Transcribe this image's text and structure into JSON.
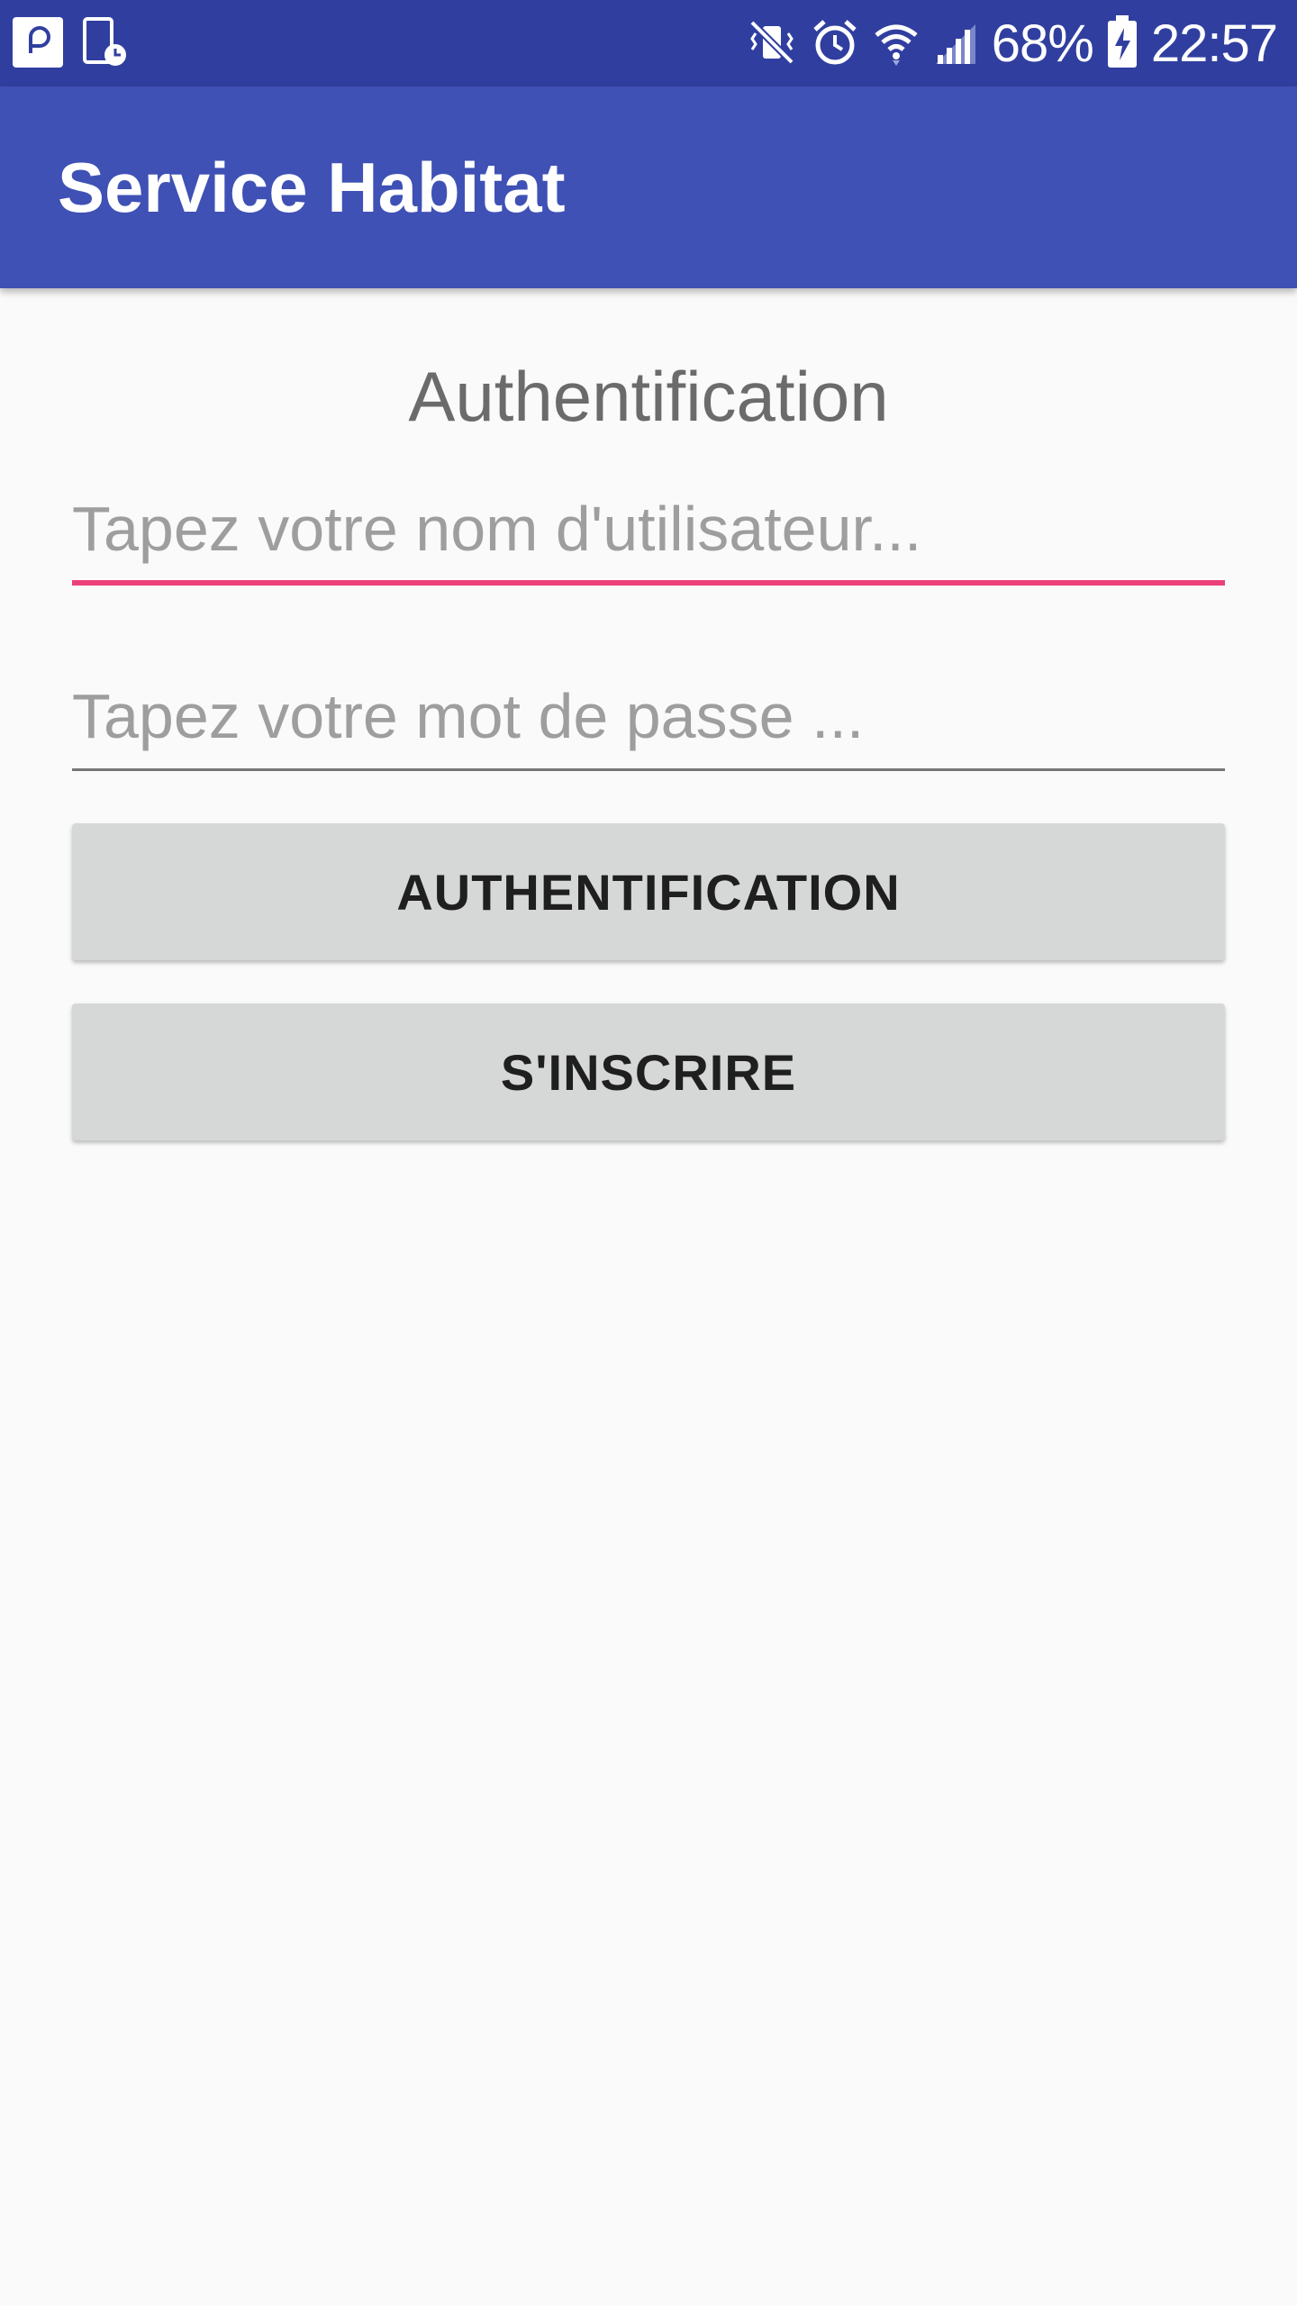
{
  "status_bar": {
    "battery": "68%",
    "time": "22:57",
    "icons": [
      "app-notification-icon",
      "screenshot-notification-icon",
      "mute-vibrate-icon",
      "alarm-icon",
      "wifi-icon",
      "cellular-signal-icon",
      "battery-charging-icon"
    ]
  },
  "app_bar": {
    "title": "Service Habitat"
  },
  "main": {
    "heading": "Authentification",
    "username_field": {
      "placeholder": "Tapez votre nom d'utilisateur...",
      "value": ""
    },
    "password_field": {
      "placeholder": "Tapez votre mot de passe ...",
      "value": ""
    },
    "login_button_label": "AUTHENTIFICATION",
    "signup_button_label": "S'INSCRIRE"
  },
  "colors": {
    "status_bar": "#303f9f",
    "app_bar": "#3f51b5",
    "accent": "#ec407a",
    "background": "#fafafa",
    "button": "#d6d7d7"
  }
}
